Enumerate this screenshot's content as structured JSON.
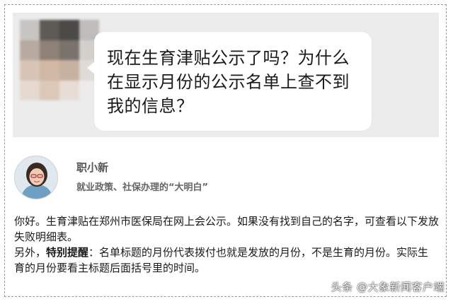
{
  "question": {
    "text": "现在生育津贴公示了吗？为什么在显示月份的公示名单上查不到我的信息？"
  },
  "profile": {
    "name": "职小新",
    "description": "就业政策、社保办理的“大明白”"
  },
  "answer": {
    "paragraph1": "你好。生育津贴在郑州市医保局在网上会公示。如果没有找到自己的名字，可查看以下发放失败明细表。",
    "p2_prefix": "另外，",
    "p2_highlight": "特别提醒",
    "p2_rest": "：名单标题的月份代表拨付也就是发放的月份，不是生育的月份。实际生育的月份要看主标题后面括号里的时间。"
  },
  "watermark": {
    "text": "头条 @大象新闻客户端"
  },
  "colors": {
    "chat_background": "#ececec",
    "bubble": "#ffffff",
    "text": "#1a1a1a",
    "profile_text": "#555555"
  }
}
